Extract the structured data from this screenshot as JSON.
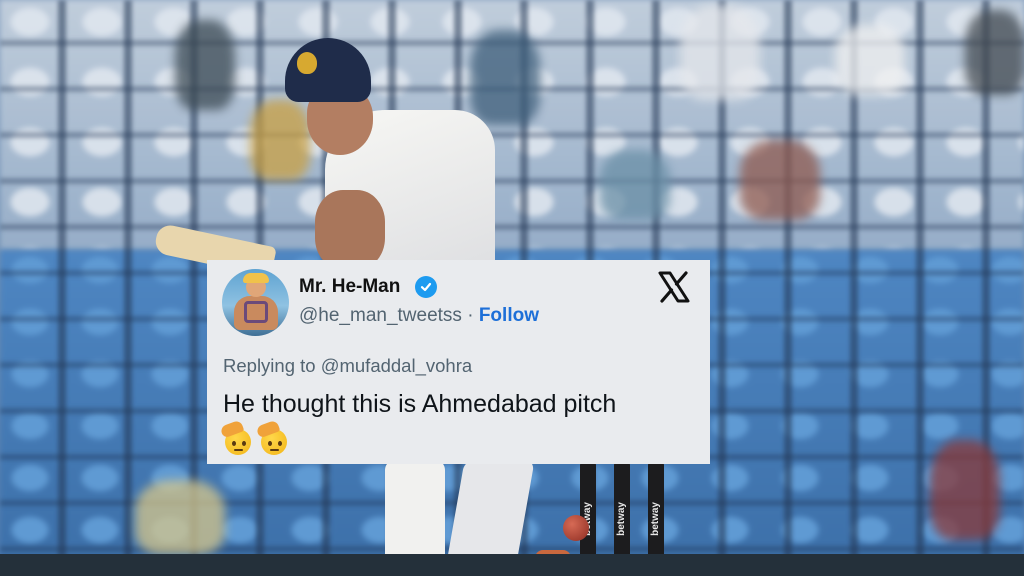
{
  "tweet": {
    "display_name": "Mr. He-Man",
    "handle": "@he_man_tweetss",
    "separator": "·",
    "follow_label": "Follow",
    "replying_to": "Replying to @mufaddal_vohra",
    "text": "He thought this is Ahmedabad pitch",
    "emojis": [
      "saluting-face",
      "saluting-face"
    ],
    "verified": true
  },
  "background": {
    "stump_sponsor": "betway"
  },
  "colors": {
    "verified_badge": "#1d9bf0",
    "follow_link": "#1d6fd8",
    "card_background": "#e9ebee",
    "secondary_text": "#536471"
  },
  "icons": {
    "platform": "x-logo-icon",
    "verified": "verified-badge-icon",
    "reaction": "saluting-face-icon"
  }
}
